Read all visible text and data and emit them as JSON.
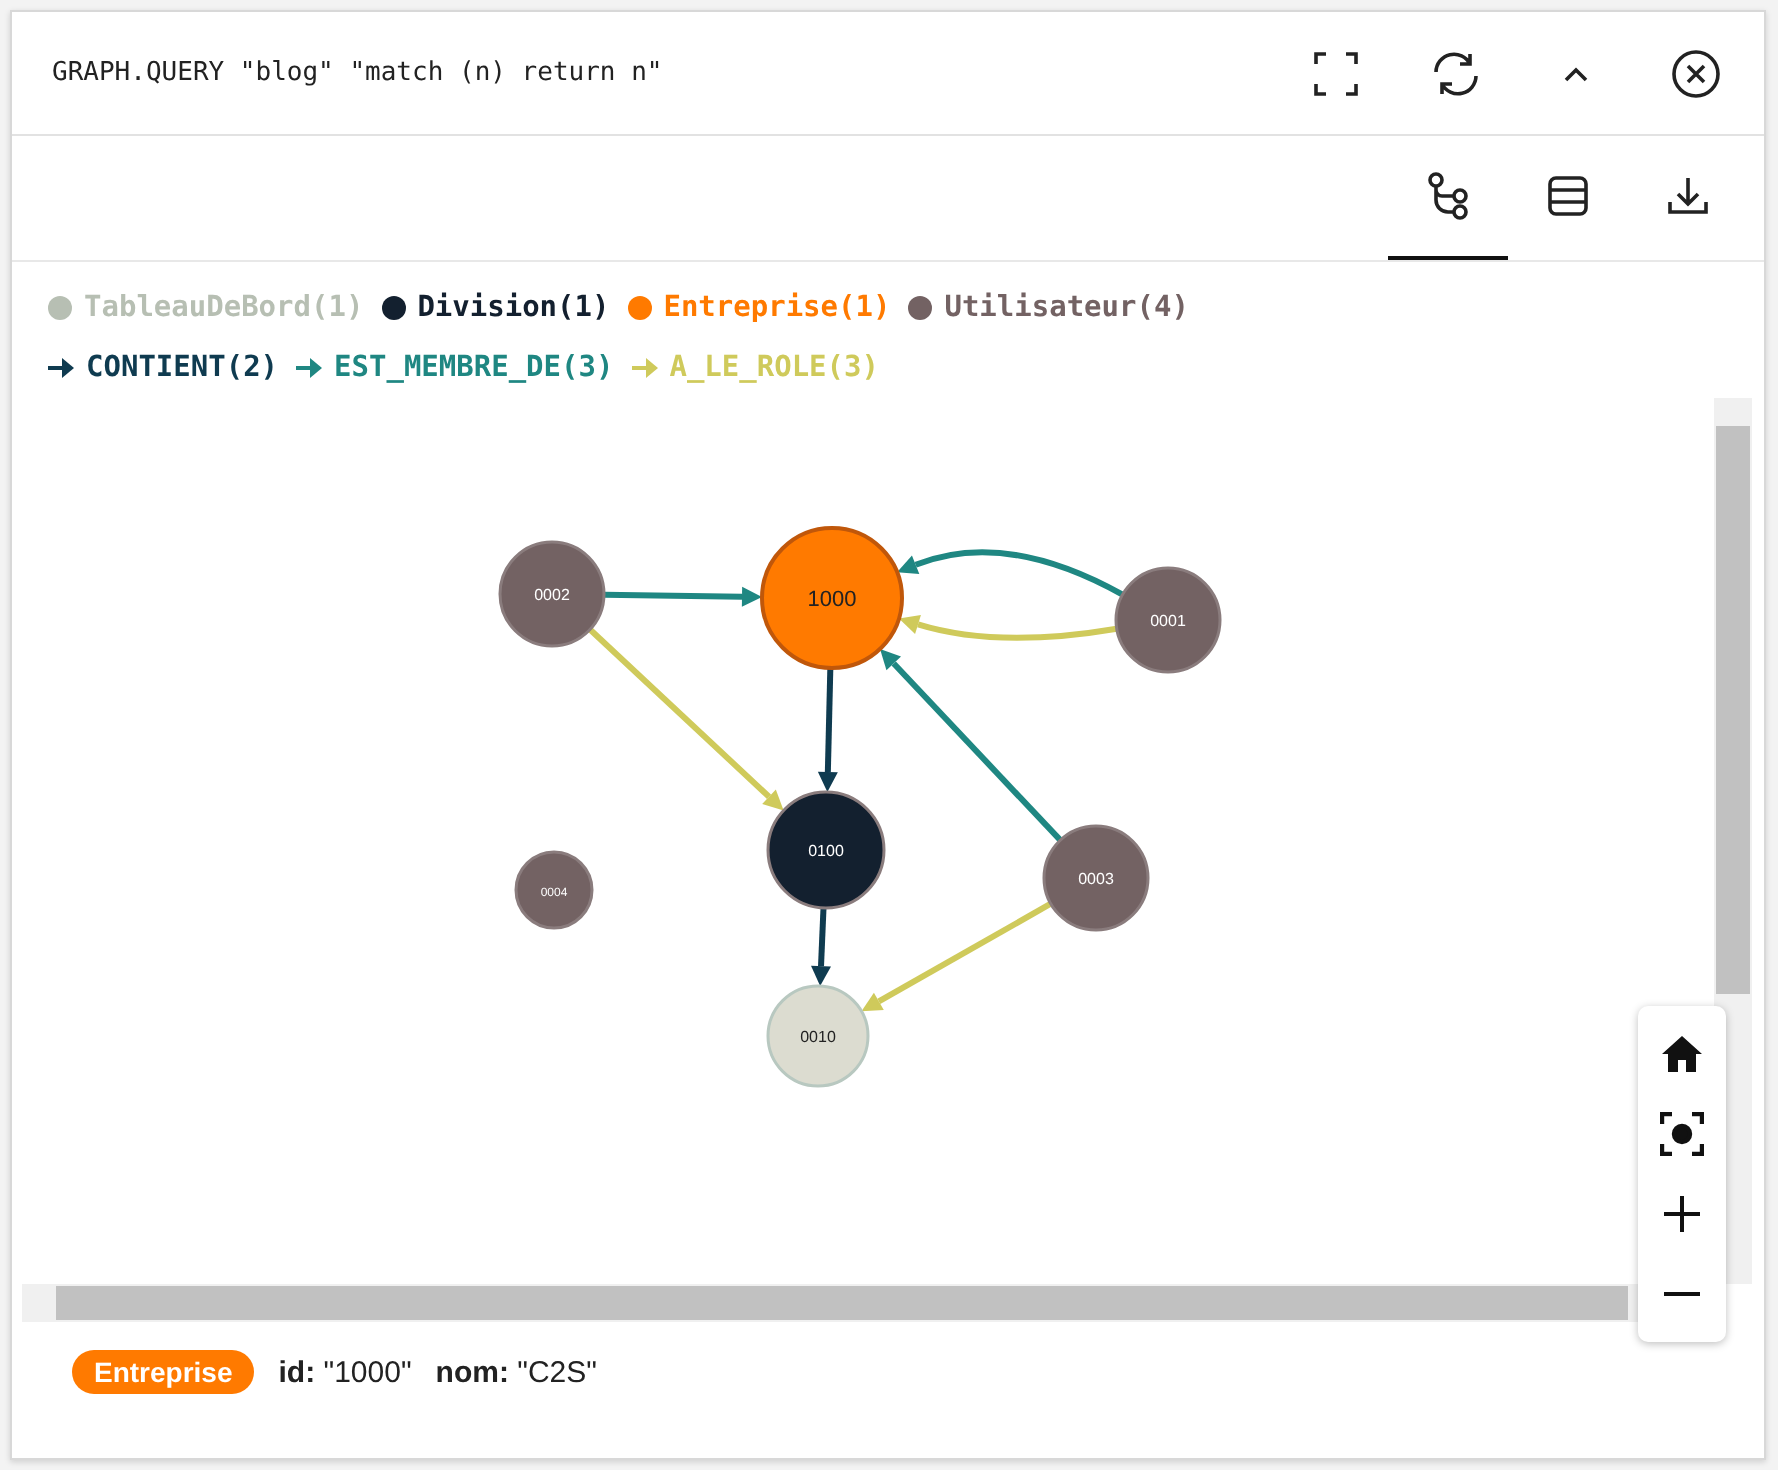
{
  "header": {
    "query": "GRAPH.QUERY \"blog\" \"match (n) return n\""
  },
  "view_tabs": [
    {
      "kind": "graph",
      "selected": true
    },
    {
      "kind": "table",
      "selected": false
    },
    {
      "kind": "download",
      "selected": false
    }
  ],
  "legend": {
    "labels": [
      {
        "text": "TableauDeBord(1)",
        "color": "#b7bfb3"
      },
      {
        "text": "Division(1)",
        "color": "#13202f"
      },
      {
        "text": "Entreprise(1)",
        "color": "#ff7a00"
      },
      {
        "text": "Utilisateur(4)",
        "color": "#736263"
      }
    ],
    "relationships": [
      {
        "text": "CONTIENT(2)",
        "color": "#0f3b50"
      },
      {
        "text": "EST_MEMBRE_DE(3)",
        "color": "#1f8782"
      },
      {
        "text": "A_LE_ROLE(3)",
        "color": "#cfca5b"
      }
    ]
  },
  "graph": {
    "nodes": [
      {
        "label": "0002",
        "color": "#736263",
        "selected": false
      },
      {
        "label": "1000",
        "color": "#ff7a00",
        "selected": true
      },
      {
        "label": "0001",
        "color": "#736263",
        "selected": false
      },
      {
        "label": "0100",
        "color": "#13202f",
        "selected": false
      },
      {
        "label": "0004",
        "color": "#736263",
        "selected": false
      },
      {
        "label": "0003",
        "color": "#736263",
        "selected": false
      },
      {
        "label": "0010",
        "color": "#dcdcd0",
        "selected": false
      }
    ],
    "edges": [
      {
        "color": "#1f8782"
      },
      {
        "color": "#1f8782"
      },
      {
        "color": "#cfca5b"
      },
      {
        "color": "#1f8782"
      },
      {
        "color": "#0f3b50"
      },
      {
        "color": "#cfca5b"
      },
      {
        "color": "#0f3b50"
      },
      {
        "color": "#cfca5b"
      }
    ]
  },
  "details": {
    "badge": {
      "text": "Entreprise",
      "color": "#ff7a00"
    },
    "properties": [
      {
        "key": "id:",
        "value": "\"1000\""
      },
      {
        "key": "nom:",
        "value": "\"C2S\""
      }
    ]
  }
}
